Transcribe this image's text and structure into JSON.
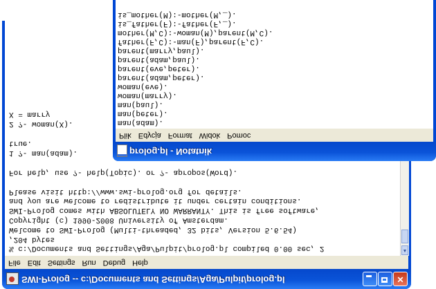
{
  "swi": {
    "title": "SWI-Prolog -- c:/Documents and Settings/Aga/Pulpit/prolog.pl",
    "menu": [
      "File",
      "Edit",
      "Settings",
      "Run",
      "Debug",
      "Help"
    ],
    "console": [
      "% c:/Documents and Settings/Aga/Pulpit/prolog.pl compiled 0.00 sec, 2",
      ",204 bytes",
      "Welcome to SWI-Prolog (Multi-threaded, 32 bits, Version 5.6.54)",
      "Copyright (c) 1990-2008 University of Amsterdam.",
      "SWI-Prolog comes with ABSOLUTELY NO WARRANTY. This is free software,",
      "and you are welcome to redistribute it under certain conditions.",
      "Please visit http://www.swi-prolog.org for details.",
      "",
      "For help, use ?- help(Topic). or ?- apropos(Word).",
      "",
      "1 ?- man(adam).",
      "true.",
      "",
      "2 ?- woman(X).",
      "X = marry"
    ]
  },
  "notepad": {
    "title": "prolog.pl - Notatnik",
    "menu": [
      "Plik",
      "Edycja",
      "Format",
      "Widok",
      "Pomoc"
    ],
    "lines": [
      "man(adam).",
      "man(peter).",
      "man(paul).",
      "woman(marry).",
      "woman(eve).",
      "parent(adam,peter).",
      "parent(eve,peter).",
      "parent(adam,paul).",
      "parent(marry,paul).",
      "father(F,C):-man(F),parent(F,C).",
      "mother(M,C):-woman(M),parent(M,C).",
      "is_father(F):-father(F,_).",
      "is_mother(M):-mother(M,_)."
    ]
  }
}
